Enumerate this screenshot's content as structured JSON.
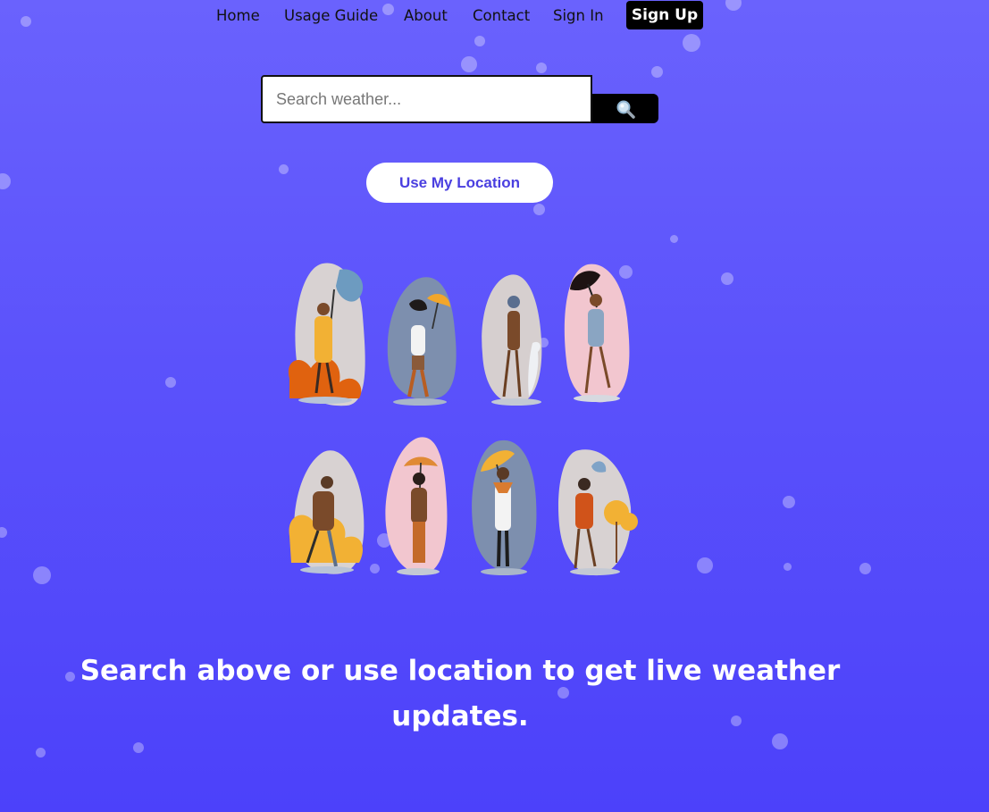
{
  "nav": {
    "items": [
      "Home",
      "Usage Guide",
      "About",
      "Contact",
      "Sign In"
    ],
    "signup_label": "Sign Up"
  },
  "search": {
    "placeholder": "Search weather...",
    "value": "",
    "button_icon": "search-icon"
  },
  "location": {
    "label": "Use My Location"
  },
  "illustration": {
    "icon": "people-in-weather-illustration",
    "panels": [
      "wind",
      "rain",
      "snow",
      "wind",
      "rain",
      "rain",
      "rain",
      "wind"
    ]
  },
  "message": {
    "text": "Search above or use location to get live weather updates."
  },
  "colors": {
    "bg_top": "#6a62fd",
    "bg_bottom": "#4c41fa",
    "accent": "#4a3fe0",
    "button_dark": "#000000"
  }
}
